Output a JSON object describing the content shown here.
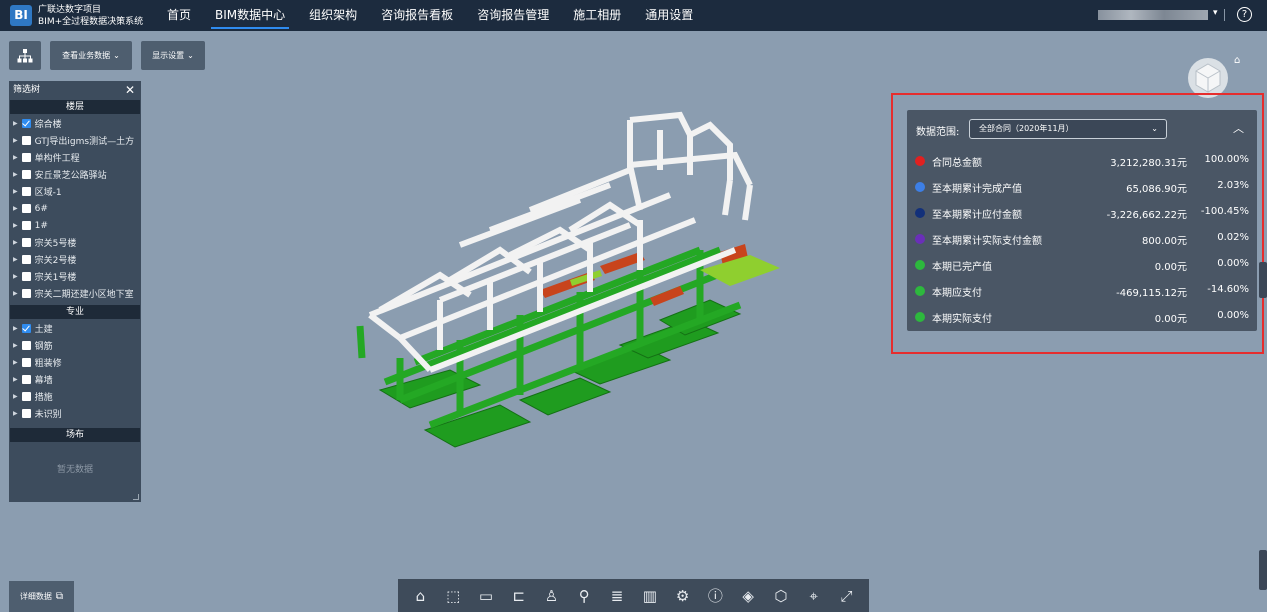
{
  "app": {
    "logo_text": "BI",
    "project_name": "广联达数字项目",
    "system_name": "BIM+全过程数据决策系统"
  },
  "nav": [
    {
      "label": "首页",
      "active": false
    },
    {
      "label": "BIM数据中心",
      "active": true
    },
    {
      "label": "组织架构",
      "active": false
    },
    {
      "label": "咨询报告看板",
      "active": false
    },
    {
      "label": "咨询报告管理",
      "active": false
    },
    {
      "label": "施工相册",
      "active": false
    },
    {
      "label": "通用设置",
      "active": false
    }
  ],
  "header": {
    "help_glyph": "?"
  },
  "toolbar": {
    "business_data_label": "查看业务数据",
    "display_settings_label": "显示设置"
  },
  "filter_tree": {
    "title": "筛选树",
    "floor_section": "楼层",
    "floors": [
      {
        "label": "综合楼",
        "checked": true
      },
      {
        "label": "GTJ导出igms测试—土方",
        "checked": false
      },
      {
        "label": "单构件工程",
        "checked": false
      },
      {
        "label": "安丘景芝公路驿站",
        "checked": false
      },
      {
        "label": "区域-1",
        "checked": false
      },
      {
        "label": "6#",
        "checked": false
      },
      {
        "label": "1#",
        "checked": false
      },
      {
        "label": "宗关5号楼",
        "checked": false
      },
      {
        "label": "宗关2号楼",
        "checked": false
      },
      {
        "label": "宗关1号楼",
        "checked": false
      },
      {
        "label": "宗关二期还建小区地下室",
        "checked": false
      }
    ],
    "discipline_section": "专业",
    "disciplines": [
      {
        "label": "土建",
        "checked": true
      },
      {
        "label": "钢筋",
        "checked": false
      },
      {
        "label": "粗装修",
        "checked": false
      },
      {
        "label": "幕墙",
        "checked": false
      },
      {
        "label": "措施",
        "checked": false
      },
      {
        "label": "未识别",
        "checked": false
      }
    ],
    "site_section": "场布",
    "empty_text": "暂无数据"
  },
  "data_panel": {
    "range_label": "数据范围:",
    "range_value": "全部合同（2020年11月）",
    "metrics": [
      {
        "label": "合同总金额",
        "value": "3,212,280.31元",
        "pct": "100.00%",
        "color": "#e02020"
      },
      {
        "label": "至本期累计完成产值",
        "value": "65,086.90元",
        "pct": "2.03%",
        "color": "#3d7fe6"
      },
      {
        "label": "至本期累计应付金额",
        "value": "-3,226,662.22元",
        "pct": "-100.45%",
        "color": "#12307a"
      },
      {
        "label": "至本期累计实际支付金额",
        "value": "800.00元",
        "pct": "0.02%",
        "color": "#6a2fb8"
      },
      {
        "label": "本期已完产值",
        "value": "0.00元",
        "pct": "0.00%",
        "color": "#2db83d"
      },
      {
        "label": "本期应支付",
        "value": "-469,115.12元",
        "pct": "-14.60%",
        "color": "#2db83d"
      },
      {
        "label": "本期实际支付",
        "value": "0.00元",
        "pct": "0.00%",
        "color": "#2db83d"
      }
    ]
  },
  "bottom": {
    "detail_label": "详细数据",
    "tools": [
      "home-icon",
      "zoom-box-icon",
      "measure-icon",
      "section-icon",
      "person-icon",
      "walk-icon",
      "list-icon",
      "chart-icon",
      "settings-icon",
      "info-icon",
      "cube-icon",
      "model-icon",
      "location-icon",
      "fullscreen-icon"
    ]
  }
}
